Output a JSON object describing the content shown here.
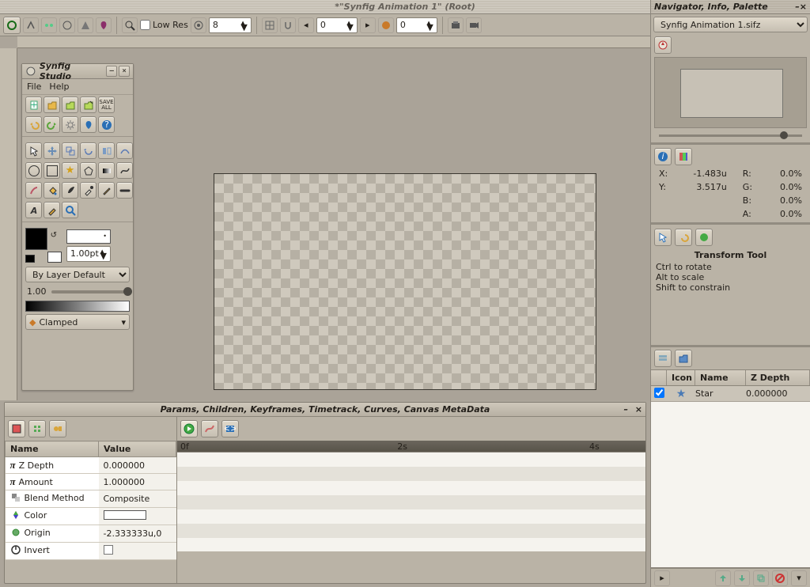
{
  "window_title": "*\"Synfig Animation 1\" (Root)",
  "right_header": "Navigator, Info, Palette",
  "file_dropdown": "Synfig Animation 1.sifz",
  "main_toolbar": {
    "lowres_label": "Low Res",
    "quality_value": "8",
    "frame_value": "0",
    "frame_value2": "0"
  },
  "toolbox": {
    "title": "Synfig Studio",
    "menu_file": "File",
    "menu_help": "Help",
    "save_all": "SAVE\nALL",
    "stroke_width": "1.00pt",
    "blend_dropdown": "By Layer Default",
    "opacity": "1.00",
    "gradient_mode": "Clamped"
  },
  "bottom": {
    "tabs": "Params, Children, Keyframes, Timetrack, Curves, Canvas MetaData",
    "col_name": "Name",
    "col_value": "Value",
    "rows": [
      {
        "name": "Z Depth",
        "value": "0.000000",
        "icon": "pi"
      },
      {
        "name": "Amount",
        "value": "1.000000",
        "icon": "pi"
      },
      {
        "name": "Blend Method",
        "value": "Composite",
        "icon": "blend"
      },
      {
        "name": "Color",
        "value": "",
        "icon": "color"
      },
      {
        "name": "Origin",
        "value": "-2.333333u,0",
        "icon": "origin"
      },
      {
        "name": "Invert",
        "value": "",
        "icon": "invert"
      }
    ],
    "time_0": "0f",
    "time_2": "2s",
    "time_4": "4s"
  },
  "info": {
    "x_label": "X:",
    "x_val": "-1.483u",
    "y_label": "Y:",
    "y_val": "3.517u",
    "r_label": "R:",
    "r_val": "0.0%",
    "g_label": "G:",
    "g_val": "0.0%",
    "b_label": "B:",
    "b_val": "0.0%",
    "a_label": "A:",
    "a_val": "0.0%",
    "tool_title": "Transform Tool",
    "hint1": "Ctrl to rotate",
    "hint2": "Alt to scale",
    "hint3": "Shift to constrain"
  },
  "layers": {
    "col_icon": "Icon",
    "col_name": "Name",
    "col_z": "Z Depth",
    "row_name": "Star",
    "row_z": "0.000000"
  }
}
